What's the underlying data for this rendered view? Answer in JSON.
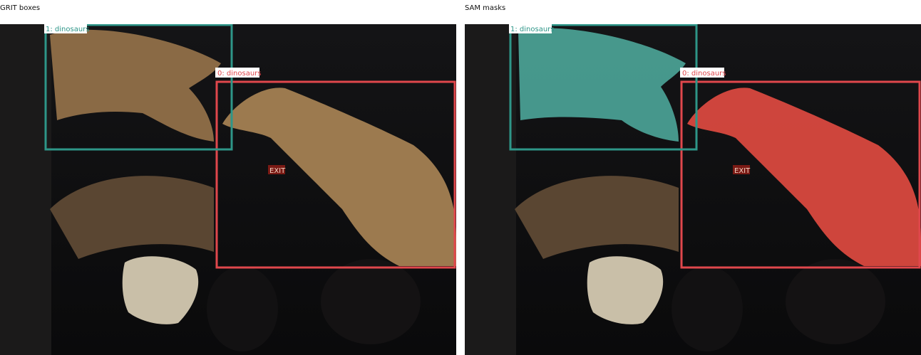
{
  "panels": [
    {
      "title": "GRIT boxes"
    },
    {
      "title": "SAM masks"
    }
  ],
  "detections": [
    {
      "label": "0: dinosaurs",
      "color": "#e0474c"
    },
    {
      "label": "1: dinosaurs",
      "color": "#2e9688"
    }
  ],
  "mask_colors": {
    "red": "#d9493f",
    "teal": "#4a9f92"
  },
  "background": {
    "scene": "#0d0d0e",
    "exit_sign": "EXIT"
  }
}
